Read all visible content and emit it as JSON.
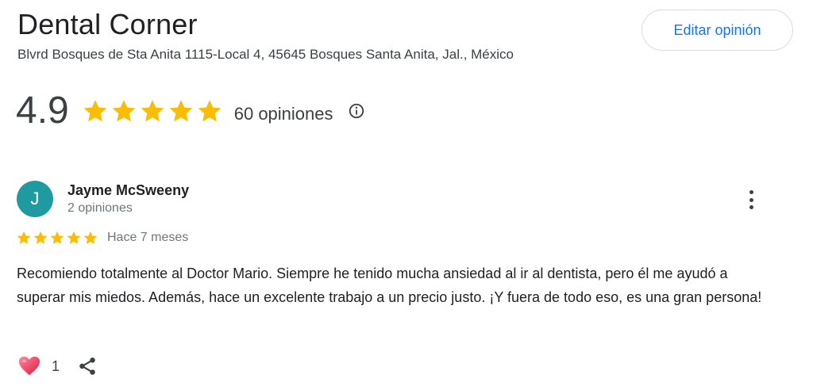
{
  "place": {
    "name": "Dental Corner",
    "address": "Blvrd Bosques de Sta Anita 1115-Local 4, 45645 Bosques Santa Anita, Jal., México",
    "edit_label": "Editar opinión",
    "rating_value": "4.9",
    "stars": 5,
    "reviews_label": "60 opiniones",
    "star_color": "#fbbc04"
  },
  "review": {
    "avatar_letter": "J",
    "avatar_color": "#1e9aa0",
    "name": "Jayme McSweeny",
    "sub": "2 opiniones",
    "stars": 5,
    "time": "Hace 7 meses",
    "text": "Recomiendo totalmente al Doctor Mario. Siempre he tenido mucha ansiedad al ir al dentista, pero él me ayudó a superar mis miedos. Además, hace un excelente trabajo a un precio justo. ¡Y fuera de todo eso, es una gran persona!",
    "likes": "1"
  },
  "icons": {
    "star": "star-icon",
    "info": "info-icon",
    "more": "more-vert-icon",
    "heart": "heart-icon",
    "share": "share-icon"
  }
}
